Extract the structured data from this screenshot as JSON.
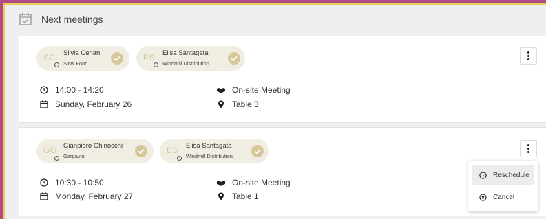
{
  "header": {
    "title": "Next meetings"
  },
  "meetings": [
    {
      "participants": [
        {
          "initials": "SC",
          "name": "Silvia Ceriani",
          "org": "Slow Food"
        },
        {
          "initials": "ES",
          "name": "Elisa Santagata",
          "org": "Windmill Distribution"
        }
      ],
      "time": "14:00 - 14:20",
      "date": "Sunday, February 26",
      "type": "On-site Meeting",
      "location": "Table 3"
    },
    {
      "participants": [
        {
          "initials": "GG",
          "name": "Gianpiero Ghinocchi",
          "org": "Gargavini"
        },
        {
          "initials": "ES",
          "name": "Elisa Santagata",
          "org": "Windmill Distribution"
        }
      ],
      "time": "10:30 - 10:50",
      "date": "Monday, February 27",
      "type": "On-site Meeting",
      "location": "Table 1"
    }
  ],
  "menu": {
    "reschedule": "Reschedule",
    "cancel": "Cancel"
  },
  "colors": {
    "background": "#b04d86",
    "frame_border": "#e9d05c",
    "chip_bg": "#f0ede3",
    "chip_accent": "#d7c79a"
  }
}
